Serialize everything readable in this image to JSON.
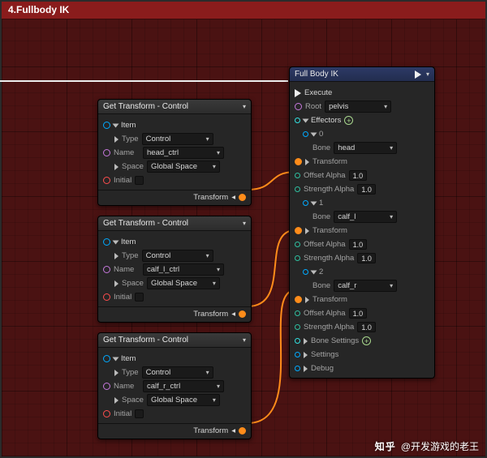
{
  "header": {
    "title": "4.Fullbody IK"
  },
  "nodes": {
    "gt1": {
      "title": "Get Transform - Control",
      "item_label": "Item",
      "type_label": "Type",
      "type_value": "Control",
      "name_label": "Name",
      "name_value": "head_ctrl",
      "space_label": "Space",
      "space_value": "Global Space",
      "initial_label": "Initial",
      "output_label": "Transform"
    },
    "gt2": {
      "title": "Get Transform - Control",
      "item_label": "Item",
      "type_label": "Type",
      "type_value": "Control",
      "name_label": "Name",
      "name_value": "calf_l_ctrl",
      "space_label": "Space",
      "space_value": "Global Space",
      "initial_label": "Initial",
      "output_label": "Transform"
    },
    "gt3": {
      "title": "Get Transform - Control",
      "item_label": "Item",
      "type_label": "Type",
      "type_value": "Control",
      "name_label": "Name",
      "name_value": "calf_r_ctrl",
      "space_label": "Space",
      "space_value": "Global Space",
      "initial_label": "Initial",
      "output_label": "Transform"
    },
    "fbik": {
      "title": "Full Body IK",
      "exec_label": "Execute",
      "root_label": "Root",
      "root_value": "pelvis",
      "effectors_label": "Effectors",
      "eff": [
        {
          "idx": "0",
          "bone_label": "Bone",
          "bone_value": "head",
          "transform_label": "Transform",
          "offset_alpha_label": "Offset Alpha",
          "offset_alpha_value": "1.0",
          "strength_alpha_label": "Strength Alpha",
          "strength_alpha_value": "1.0"
        },
        {
          "idx": "1",
          "bone_label": "Bone",
          "bone_value": "calf_l",
          "transform_label": "Transform",
          "offset_alpha_label": "Offset Alpha",
          "offset_alpha_value": "1.0",
          "strength_alpha_label": "Strength Alpha",
          "strength_alpha_value": "1.0"
        },
        {
          "idx": "2",
          "bone_label": "Bone",
          "bone_value": "calf_r",
          "transform_label": "Transform",
          "offset_alpha_label": "Offset Alpha",
          "offset_alpha_value": "1.0",
          "strength_alpha_label": "Strength Alpha",
          "strength_alpha_value": "1.0"
        }
      ],
      "bone_settings_label": "Bone Settings",
      "settings_label": "Settings",
      "debug_label": "Debug"
    }
  },
  "watermark": {
    "logo": "知乎",
    "at": "@开发游戏的老王"
  }
}
